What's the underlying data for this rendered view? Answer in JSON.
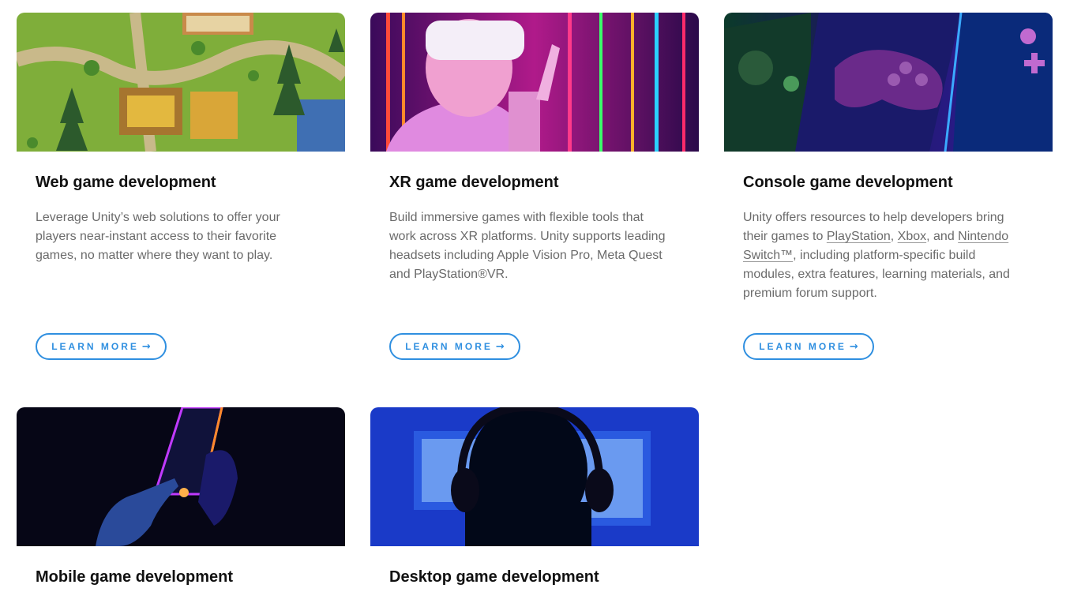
{
  "cards": [
    {
      "title": "Web game development",
      "description": "Leverage Unity’s web solutions to offer your players near-instant access to their favorite games, no matter where they want to play.",
      "button_label": "LEARN MORE",
      "button_icon": "arrow-right-icon",
      "image": "pixel-art-farm-village-image"
    },
    {
      "title": "XR game development",
      "description": "Build immersive games with flexible tools that work across XR platforms. Unity supports leading headsets including Apple Vision Pro, Meta Quest and PlayStation®VR.",
      "button_label": "LEARN MORE",
      "button_icon": "arrow-right-icon",
      "image": "person-in-vr-headset-neon-image"
    },
    {
      "title": "Console game development",
      "description_parts": {
        "intro": "Unity offers resources to help developers bring their games to ",
        "link_playstation": "PlayStation",
        "sep1": ", ",
        "link_xbox": "Xbox",
        "sep2": ", and ",
        "link_nintendo": "Nintendo Switch™",
        "outro": ", including platform-specific build modules, extra features, learning materials, and premium forum support."
      },
      "button_label": "LEARN MORE",
      "button_icon": "arrow-right-icon",
      "image": "game-controllers-neon-image"
    },
    {
      "title": "Mobile game development",
      "image": "neon-hand-touching-phone-image"
    },
    {
      "title": "Desktop game development",
      "image": "gamer-with-headphones-at-monitor-image"
    }
  ],
  "colors": {
    "accent": "#2f8fe0",
    "title_text": "#111111",
    "body_text": "#6b6b6b"
  }
}
